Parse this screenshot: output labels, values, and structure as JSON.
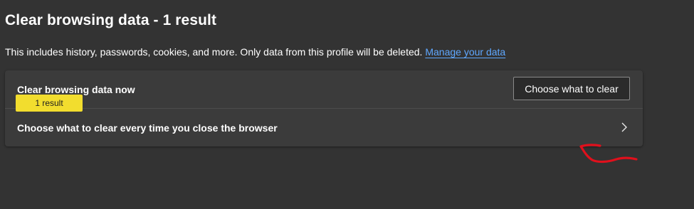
{
  "page": {
    "title": "Clear browsing data - 1 result",
    "description": "This includes history, passwords, cookies, and more. Only data from this profile will be deleted.",
    "manage_link": "Manage your data"
  },
  "card": {
    "row1_label": "Clear browsing data now",
    "row1_button": "Choose what to clear",
    "badge": "1 result",
    "row2_label": "Choose what to clear every time you close the browser",
    "row2_icon": "chevron-right-icon"
  },
  "colors": {
    "background": "#333333",
    "card": "#3b3b3b",
    "link": "#5fa8ff",
    "badge": "#f2dd2e",
    "annotation": "#e0101c"
  },
  "annotation": {
    "type": "hand-drawn red arrow pointing at the chevron"
  }
}
